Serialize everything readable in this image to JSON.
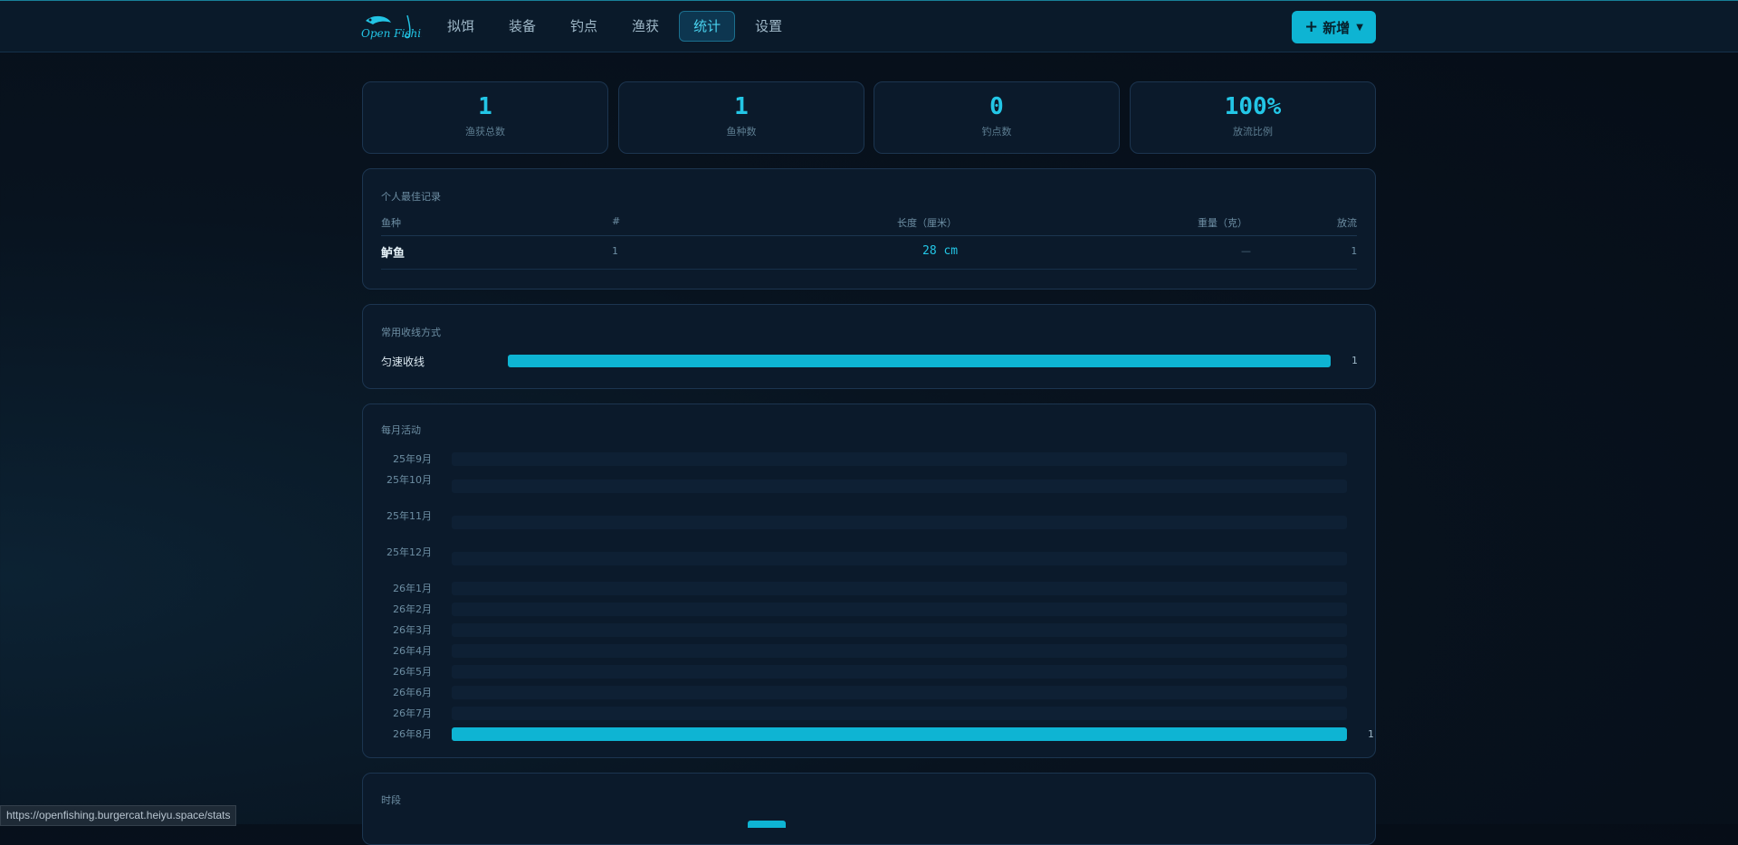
{
  "nav": {
    "items": [
      {
        "label": "拟饵",
        "active": false
      },
      {
        "label": "装备",
        "active": false
      },
      {
        "label": "钓点",
        "active": false
      },
      {
        "label": "渔获",
        "active": false
      },
      {
        "label": "统计",
        "active": true
      },
      {
        "label": "设置",
        "active": false
      }
    ],
    "new_button": "新增",
    "logo_text": "Open Fishing"
  },
  "stats": [
    {
      "value": "1",
      "label": "渔获总数"
    },
    {
      "value": "1",
      "label": "鱼种数"
    },
    {
      "value": "0",
      "label": "钓点数"
    },
    {
      "value": "100%",
      "label": "放流比例"
    }
  ],
  "records": {
    "title": "个人最佳记录",
    "headers": [
      "鱼种",
      "#",
      "长度（厘米）",
      "重量（克）",
      "放流"
    ],
    "rows": [
      {
        "species": "鲈鱼",
        "count": "1",
        "length": "28 cm",
        "weight": "—",
        "released": "1"
      }
    ]
  },
  "retrieve": {
    "title": "常用收线方式",
    "items": [
      {
        "label": "匀速收线",
        "count": "1",
        "fraction": 1.0
      }
    ]
  },
  "monthly": {
    "title": "每月活动",
    "months": [
      {
        "label": "25年9月",
        "count": 0
      },
      {
        "label": "25年10月",
        "count": 0
      },
      {
        "label": "25年11月",
        "count": 0
      },
      {
        "label": "25年12月",
        "count": 0
      },
      {
        "label": "26年1月",
        "count": 0
      },
      {
        "label": "26年2月",
        "count": 0
      },
      {
        "label": "26年3月",
        "count": 0
      },
      {
        "label": "26年4月",
        "count": 0
      },
      {
        "label": "26年5月",
        "count": 0
      },
      {
        "label": "26年6月",
        "count": 0
      },
      {
        "label": "26年7月",
        "count": 0
      },
      {
        "label": "26年8月",
        "count": 1
      }
    ],
    "max": 1
  },
  "timeofday": {
    "title": "时段"
  },
  "status_url": "https://openfishing.burgercat.heiyu.space/stats",
  "colors": {
    "accent": "#0eb4d3",
    "bg": "#08131f",
    "card": "#0b1a2b"
  }
}
